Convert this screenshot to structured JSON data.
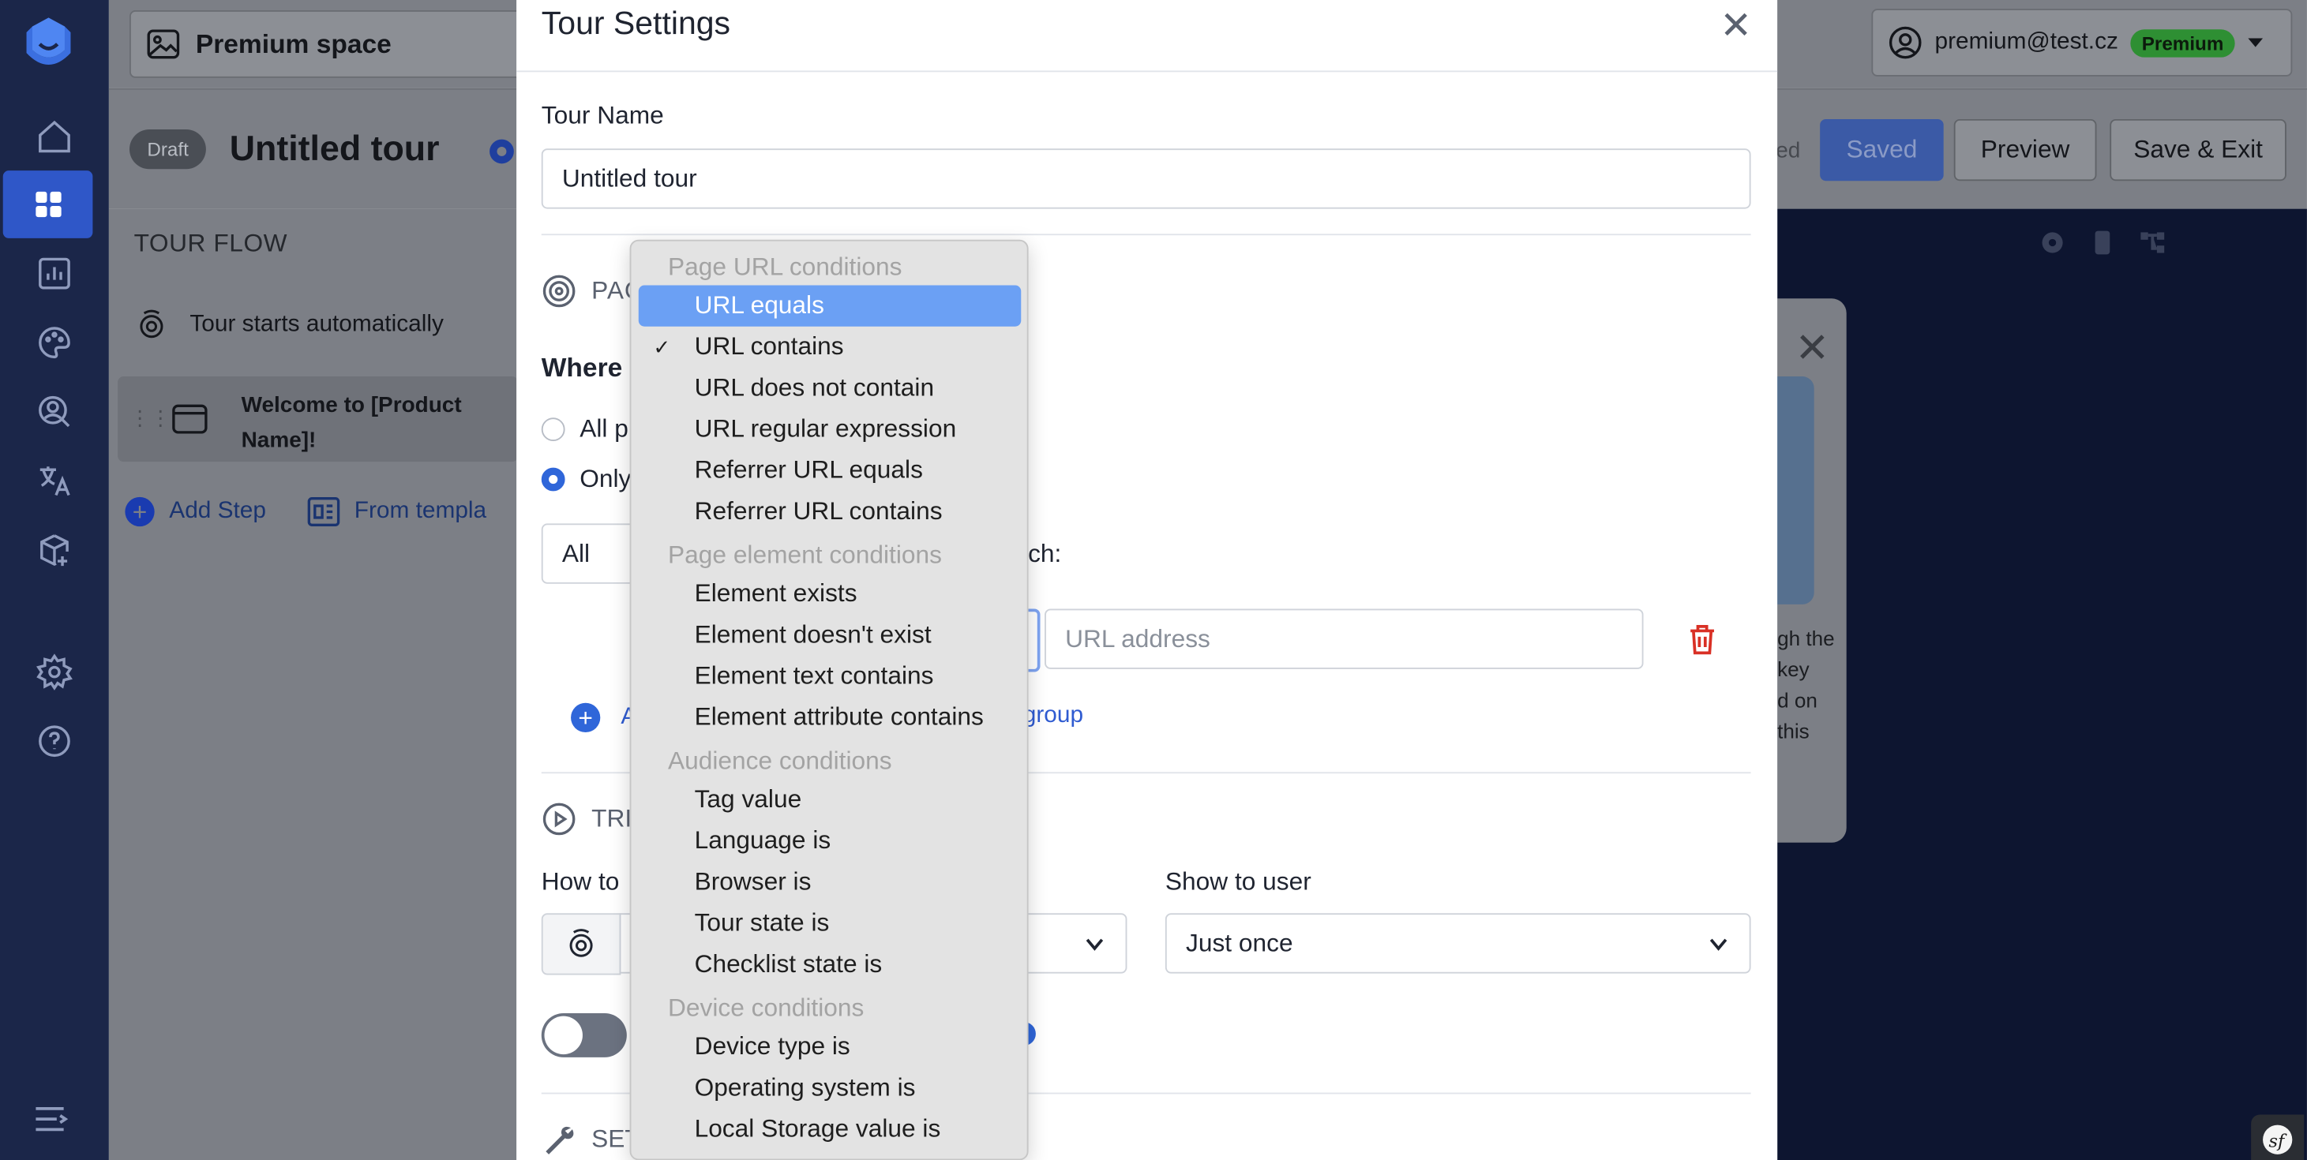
{
  "app": {
    "space_name": "Premium space",
    "user_email": "premium@test.cz",
    "plan_badge": "Premium",
    "status_badge": "Draft",
    "tour_title": "Untitled tour",
    "saved_hint": "ed",
    "buttons": {
      "saved": "Saved",
      "preview": "Preview",
      "save_exit": "Save & Exit"
    }
  },
  "left_panel": {
    "title": "TOUR FLOW",
    "trigger_row": "Tour starts automatically",
    "step": {
      "line1": "Welcome to [Product",
      "line2": "Name]!"
    },
    "add_step": "Add Step",
    "from_template": "From templa"
  },
  "canvas": {
    "card_text_line1": "gh the key",
    "card_text_line2": "d on this"
  },
  "modal": {
    "title": "Tour Settings",
    "tour_name_label": "Tour Name",
    "tour_name_value": "Untitled tour",
    "pages_section_label": "PAG",
    "where_label": "Where",
    "radio_all": "All p",
    "radio_only": "Only",
    "match_select_value": "All",
    "match_suffix": "tch:",
    "url_placeholder": "URL address",
    "add_condition": "A",
    "add_group": "n group",
    "trigger_section_label": "TRI",
    "how_to_label": "How to",
    "show_to_user_label": "Show to user",
    "show_to_user_value": "Just once",
    "settings_section_label": "SET"
  },
  "dropdown": {
    "groups": [
      {
        "label": "Page URL conditions",
        "items": [
          "URL equals",
          "URL contains",
          "URL does not contain",
          "URL regular expression",
          "Referrer URL equals",
          "Referrer URL contains"
        ]
      },
      {
        "label": "Page element conditions",
        "items": [
          "Element exists",
          "Element doesn't exist",
          "Element text contains",
          "Element attribute contains"
        ]
      },
      {
        "label": "Audience conditions",
        "items": [
          "Tag value",
          "Language is",
          "Browser is",
          "Tour state is",
          "Checklist state is"
        ]
      },
      {
        "label": "Device conditions",
        "items": [
          "Device type is",
          "Operating system is",
          "Local Storage value is"
        ]
      }
    ],
    "highlighted": "URL equals",
    "checked": "URL contains",
    "check_mark": "✓"
  },
  "colors": {
    "rail": "#1b2649",
    "accent": "#2f66d9",
    "highlight": "#6ba0f4",
    "premium": "#2e8f33",
    "danger": "#d93025"
  }
}
